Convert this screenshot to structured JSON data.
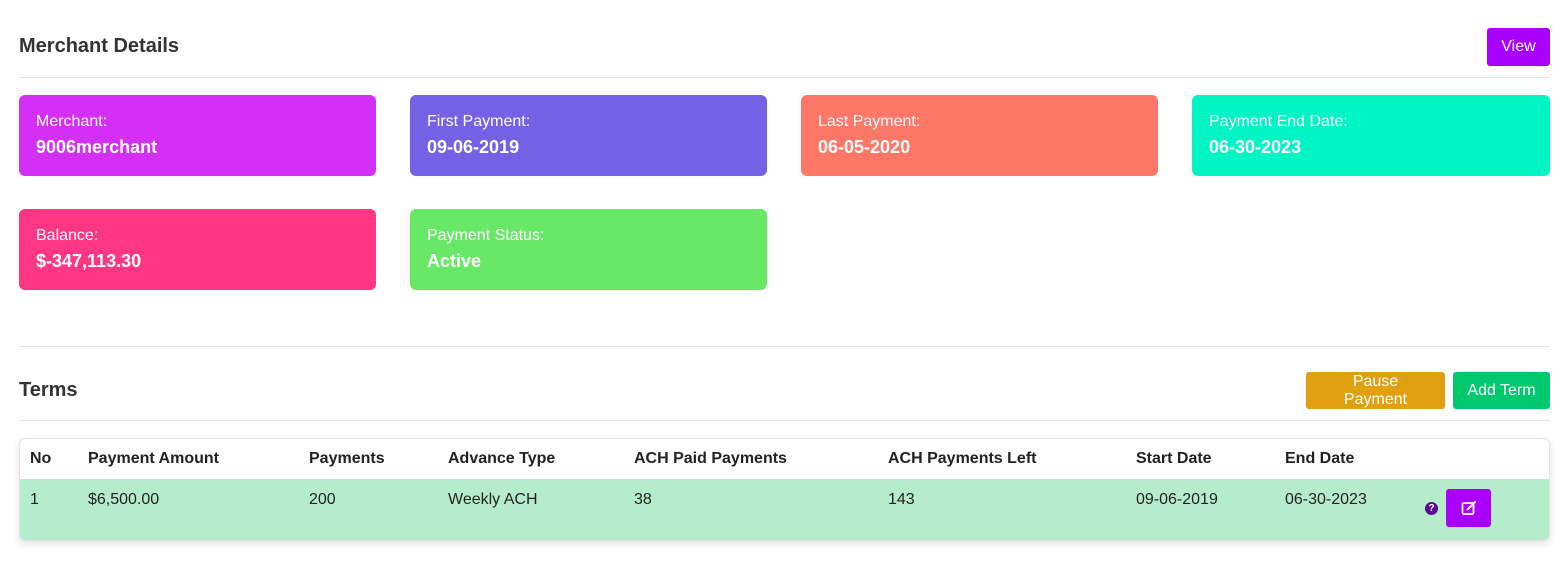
{
  "merchant_details": {
    "title": "Merchant Details",
    "view_button": "View",
    "cards": [
      {
        "label": "Merchant:",
        "value": "9006merchant",
        "color": "#d42ff4"
      },
      {
        "label": "First Payment:",
        "value": "09-06-2019",
        "color": "#7561e6"
      },
      {
        "label": "Last Payment:",
        "value": "06-05-2020",
        "color": "#ff7766"
      },
      {
        "label": "Payment End Date:",
        "value": "06-30-2023",
        "color": "#00f5c4"
      },
      {
        "label": "Balance:",
        "value": "$-347,113.30",
        "color": "#ff3683"
      },
      {
        "label": "Payment Status:",
        "value": "Active",
        "color": "#69e868"
      }
    ]
  },
  "terms": {
    "title": "Terms",
    "pause_button": "Pause Payment",
    "add_button": "Add Term",
    "columns": [
      "No",
      "Payment Amount",
      "Payments",
      "Advance Type",
      "ACH Paid Payments",
      "ACH Payments Left",
      "Start Date",
      "End Date"
    ],
    "rows": [
      {
        "no": "1",
        "payment_amount": "$6,500.00",
        "payments": "200",
        "advance_type": "Weekly ACH",
        "ach_paid_payments": "38",
        "ach_payments_left": "143",
        "start_date": "09-06-2019",
        "end_date": "06-30-2023"
      }
    ],
    "help_icon": "?"
  },
  "colors": {
    "view_button": "#aa00ff",
    "pause_button": "#e0a010",
    "add_button": "#00c86c",
    "edit_button": "#aa00ff",
    "row_highlight": "#b5edcc"
  },
  "icons": {
    "help": "question-circle-icon",
    "edit": "edit-icon"
  }
}
